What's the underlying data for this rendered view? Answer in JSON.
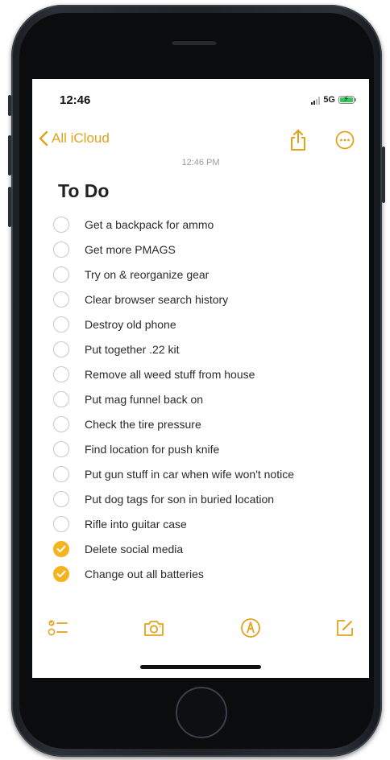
{
  "status_bar": {
    "time": "12:46",
    "network": "5G"
  },
  "nav": {
    "back_label": "All iCloud"
  },
  "note": {
    "timestamp": "12:46 PM",
    "title": "To Do",
    "items": [
      {
        "text": "Get a backpack for ammo",
        "checked": false
      },
      {
        "text": "Get more PMAGS",
        "checked": false
      },
      {
        "text": "Try on & reorganize gear",
        "checked": false
      },
      {
        "text": "Clear browser search history",
        "checked": false
      },
      {
        "text": "Destroy old phone",
        "checked": false
      },
      {
        "text": "Put together .22 kit",
        "checked": false
      },
      {
        "text": "Remove all weed stuff from house",
        "checked": false
      },
      {
        "text": "Put mag funnel back on",
        "checked": false
      },
      {
        "text": "Check the tire pressure",
        "checked": false
      },
      {
        "text": "Find location for push knife",
        "checked": false
      },
      {
        "text": "Put gun stuff in car when wife won't notice",
        "checked": false
      },
      {
        "text": "Put dog tags for son in buried location",
        "checked": false
      },
      {
        "text": "Rifle into guitar case",
        "checked": false
      },
      {
        "text": "Delete social media",
        "checked": true
      },
      {
        "text": "Change out all batteries",
        "checked": true
      }
    ]
  },
  "icons": {
    "back": "chevron-left-icon",
    "share": "share-icon",
    "more": "ellipsis-circle-icon",
    "checklist": "checklist-icon",
    "camera": "camera-icon",
    "markup": "markup-pen-icon",
    "compose": "compose-icon"
  },
  "colors": {
    "accent": "#e3a21a",
    "checked_fill": "#f5b41e",
    "battery": "#34c759"
  }
}
